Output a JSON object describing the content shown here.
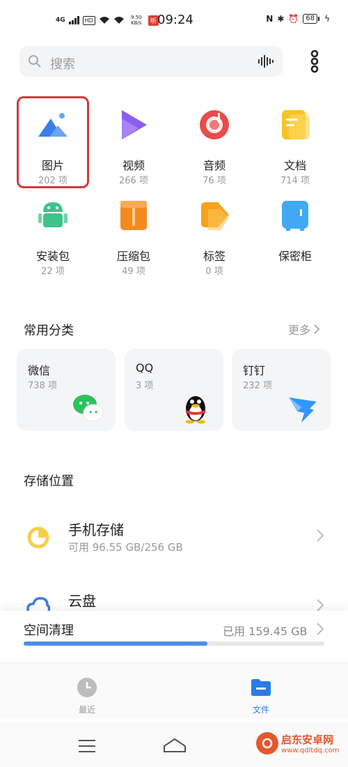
{
  "status": {
    "network": "4G",
    "hd": "HD",
    "speed": "9.50 KB/s",
    "app_badge": "听",
    "time": "09:24",
    "battery": "68"
  },
  "search": {
    "placeholder": "搜索"
  },
  "categories": [
    {
      "label": "图片",
      "count": "202 项",
      "icon": "image-icon",
      "color": "#3b7dea"
    },
    {
      "label": "视频",
      "count": "266 项",
      "icon": "video-icon",
      "color": "#8a5cf0"
    },
    {
      "label": "音频",
      "count": "76 项",
      "icon": "music-icon",
      "color": "#ea4b4b"
    },
    {
      "label": "文档",
      "count": "714 项",
      "icon": "document-icon",
      "color": "#f7c325"
    },
    {
      "label": "安装包",
      "count": "22 项",
      "icon": "android-icon",
      "color": "#3cc48a"
    },
    {
      "label": "压缩包",
      "count": "49 项",
      "icon": "zip-icon",
      "color": "#f38a1f"
    },
    {
      "label": "标签",
      "count": "0 项",
      "icon": "tag-icon",
      "color": "#f7a21b"
    },
    {
      "label": "保密柜",
      "count": "",
      "icon": "safe-icon",
      "color": "#3fa9f5"
    }
  ],
  "common": {
    "title": "常用分类",
    "more": "更多",
    "cards": [
      {
        "name": "微信",
        "count": "738 项",
        "icon": "wechat-icon"
      },
      {
        "name": "QQ",
        "count": "3 项",
        "icon": "qq-icon"
      },
      {
        "name": "钉钉",
        "count": "232 项",
        "icon": "dingtalk-icon"
      }
    ]
  },
  "storage": {
    "title": "存储位置",
    "phone": {
      "name": "手机存储",
      "sub": "可用 96.55 GB/256 GB"
    },
    "cloud": {
      "name": "云盘"
    }
  },
  "cleanup": {
    "title": "空间清理",
    "used": "已用 159.45 GB",
    "fill_fraction": 0.61
  },
  "nav": {
    "recent": "最近",
    "files": "文件",
    "active_color": "#2a7be4"
  },
  "watermark": {
    "cn": "启东安卓网",
    "url": "www.qdltdq.com"
  }
}
